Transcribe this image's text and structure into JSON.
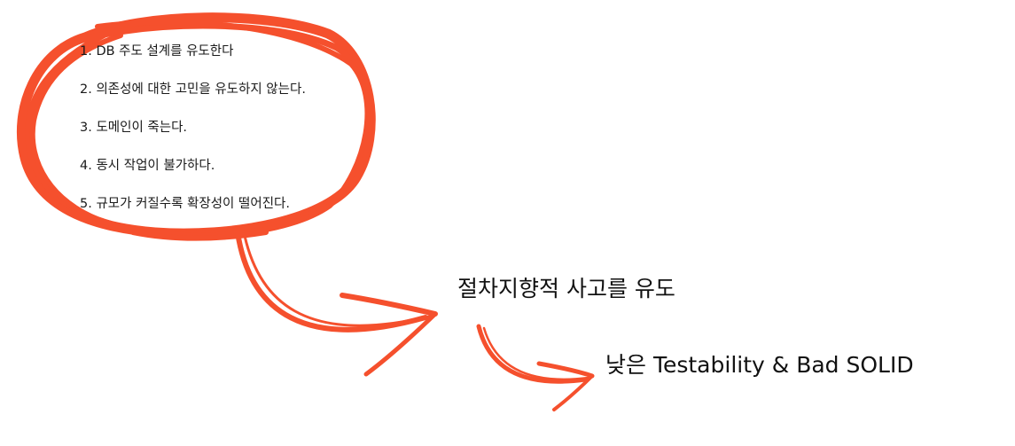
{
  "problems": [
    "1. DB 주도 설계를 유도한다",
    "2. 의존성에 대한 고민을 유도하지 않는다.",
    "3. 도메인이 죽는다.",
    "4. 동시 작업이 불가하다.",
    "5. 규모가 커질수록 확장성이 떨어진다."
  ],
  "consequence_1": "절차지향적 사고를 유도",
  "consequence_2": "낮은 Testability & Bad SOLID",
  "colors": {
    "accent": "#f5502d",
    "text": "#111111"
  }
}
